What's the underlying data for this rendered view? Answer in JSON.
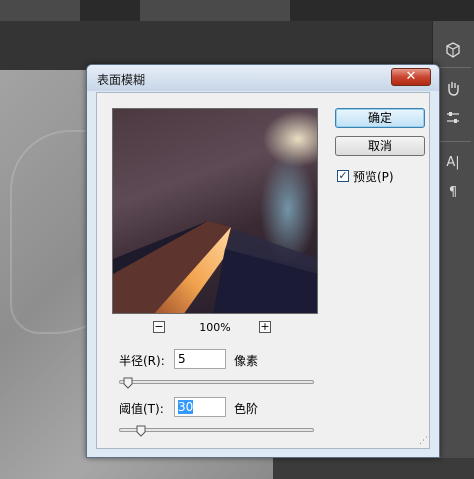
{
  "dialog": {
    "title": "表面模糊",
    "close_label": "✕",
    "ok_label": "确定",
    "cancel_label": "取消",
    "preview_label": "预览(P)",
    "preview_checked": true,
    "zoom_out_label": "−",
    "zoom_in_label": "+",
    "zoom_level": "100%",
    "radius": {
      "label": "半径(R):",
      "value": "5",
      "unit": "像素",
      "slider_fraction": 0.04
    },
    "threshold": {
      "label": "阈值(T):",
      "value": "30",
      "unit": "色阶",
      "slider_fraction": 0.11
    }
  },
  "right_panel": {
    "icons": [
      "cube-icon",
      "hand-tool-icon",
      "adjust-sliders-icon",
      "type-icon",
      "paragraph-icon"
    ],
    "type_glyph": "A|",
    "paragraph_glyph": "¶"
  },
  "colors": {
    "dialog_frame": "#dfe9f4",
    "close_button": "#c8452f",
    "ok_button": "#bfe1f6",
    "selection": "#3399ff"
  }
}
